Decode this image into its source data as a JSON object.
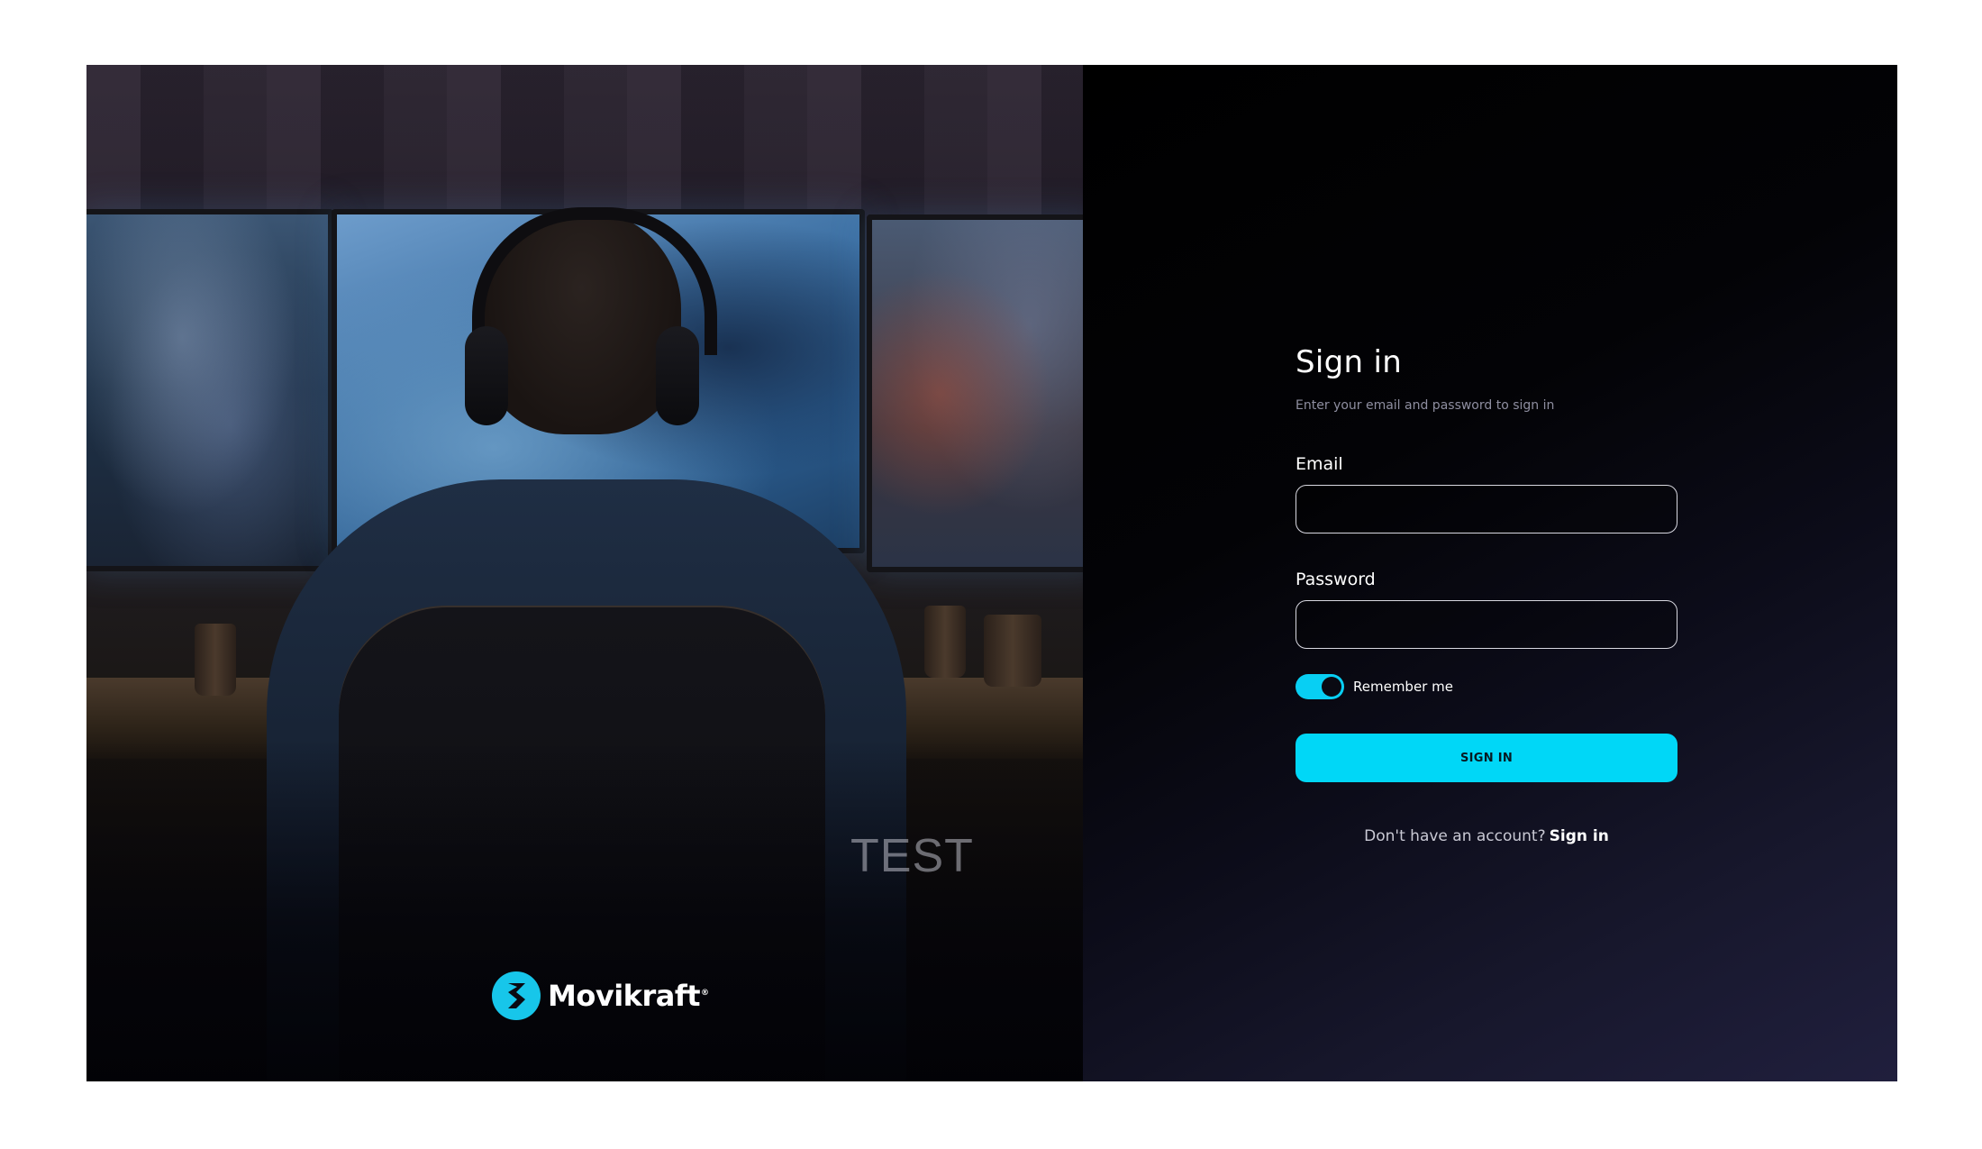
{
  "hero": {
    "watermark": "TEST",
    "brand": {
      "name": "Movikraft",
      "trademark": "®",
      "logo_icon": "movikraft-logo-icon",
      "logo_color": "#17c6ea"
    }
  },
  "signin": {
    "title": "Sign in",
    "subtitle": "Enter your email and password to sign in",
    "email_label": "Email",
    "email_value": "",
    "password_label": "Password",
    "password_value": "",
    "remember_label": "Remember me",
    "remember_checked": true,
    "submit_label": "SIGN IN",
    "footer_text": "Don't have an account?",
    "footer_link": "Sign in"
  },
  "colors": {
    "accent": "#00d7f7",
    "panel_dark": "#000000",
    "panel_light": "#201f3d",
    "text": "#ffffff",
    "muted": "#8e8ea0"
  }
}
